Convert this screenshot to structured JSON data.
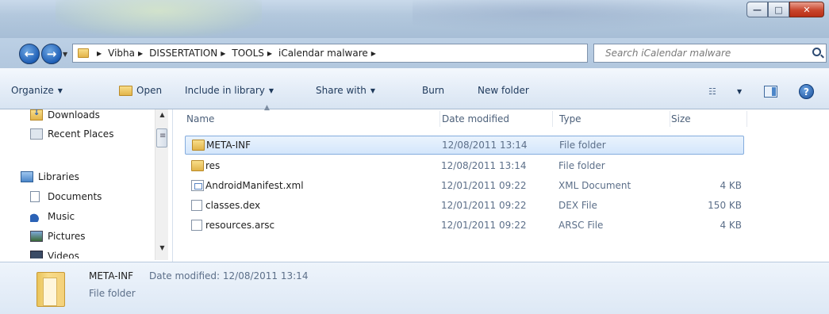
{
  "window": {
    "minimize_glyph": "—",
    "maximize_glyph": "□",
    "close_glyph": "✕"
  },
  "nav": {
    "back_glyph": "←",
    "forward_glyph": "→"
  },
  "breadcrumb": [
    "Vibha",
    "DISSERTATION",
    "TOOLS",
    "iCalendar malware"
  ],
  "search": {
    "placeholder": "Search iCalendar malware"
  },
  "toolbar": {
    "organize": "Organize",
    "open": "Open",
    "include_in_library": "Include in library",
    "share_with": "Share with",
    "burn": "Burn",
    "new_folder": "New folder"
  },
  "sidebar": {
    "items": [
      {
        "label": "Downloads",
        "icon": "downloads-folder-icon"
      },
      {
        "label": "Recent Places",
        "icon": "recent-places-icon"
      },
      {
        "label": "Libraries",
        "icon": "libraries-icon"
      },
      {
        "label": "Documents",
        "icon": "documents-icon"
      },
      {
        "label": "Music",
        "icon": "music-icon"
      },
      {
        "label": "Pictures",
        "icon": "pictures-icon"
      },
      {
        "label": "Videos",
        "icon": "videos-icon"
      }
    ]
  },
  "columns": {
    "name": "Name",
    "date": "Date modified",
    "type": "Type",
    "size": "Size"
  },
  "files": [
    {
      "name": "META-INF",
      "date": "12/08/2011 13:14",
      "type": "File folder",
      "size": "",
      "icon": "folder-icon",
      "selected": true
    },
    {
      "name": "res",
      "date": "12/08/2011 13:14",
      "type": "File folder",
      "size": "",
      "icon": "folder-icon",
      "selected": false
    },
    {
      "name": "AndroidManifest.xml",
      "date": "12/01/2011 09:22",
      "type": "XML Document",
      "size": "4 KB",
      "icon": "xml-file-icon",
      "selected": false
    },
    {
      "name": "classes.dex",
      "date": "12/01/2011 09:22",
      "type": "DEX File",
      "size": "150 KB",
      "icon": "file-icon",
      "selected": false
    },
    {
      "name": "resources.arsc",
      "date": "12/01/2011 09:22",
      "type": "ARSC File",
      "size": "4 KB",
      "icon": "file-icon",
      "selected": false
    }
  ],
  "details": {
    "name": "META-INF",
    "date_label": "Date modified: 12/08/2011 13:14",
    "type": "File folder"
  },
  "colors": {
    "selection_border": "#84acdd",
    "close_button": "#c8452c",
    "accent_blue": "#1f5fb6"
  }
}
